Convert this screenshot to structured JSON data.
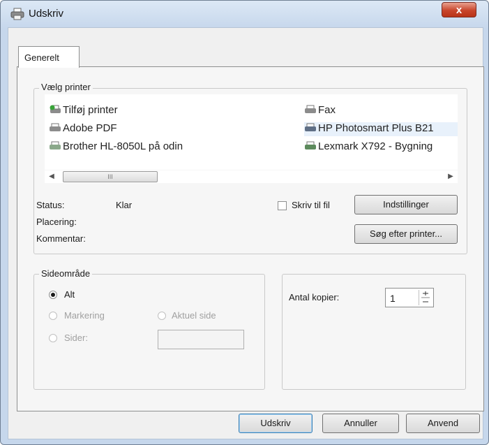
{
  "window": {
    "title": "Udskriv",
    "close_label": "x"
  },
  "tabs": [
    {
      "label": "Generelt"
    }
  ],
  "printer_group": {
    "legend": "Vælg printer",
    "printers": [
      {
        "name": "Tilføj printer"
      },
      {
        "name": "Adobe PDF"
      },
      {
        "name": "Brother HL-8050L på odin"
      },
      {
        "name": "Fax"
      },
      {
        "name": "HP Photosmart Plus B21"
      },
      {
        "name": "Lexmark X792 - Bygning"
      }
    ],
    "selected": "HP Photosmart Plus B21",
    "scroll_thumb_label": "III",
    "status_label": "Status:",
    "status_value": "Klar",
    "location_label": "Placering:",
    "comment_label": "Kommentar:",
    "print_to_file_label": "Skriv til fil",
    "print_to_file_checked": false,
    "settings_button": "Indstillinger",
    "find_printer_button": "Søg efter printer..."
  },
  "page_range": {
    "legend": "Sideområde",
    "all_label": "Alt",
    "selection_label": "Markering",
    "current_page_label": "Aktuel side",
    "pages_label": "Sider:",
    "selected": "Alt",
    "pages_value": ""
  },
  "copies": {
    "label": "Antal kopier:",
    "value": "1"
  },
  "buttons": {
    "print": "Udskriv",
    "cancel": "Annuller",
    "apply": "Anvend"
  },
  "colors": {
    "title_bar": "#c6d7ec",
    "close_button": "#c8452b",
    "selection_highlight": "#e8f1fb"
  },
  "icons": {
    "app": "printer-icon",
    "add_printer": "add-printer-icon",
    "printer": "printer-icon"
  }
}
